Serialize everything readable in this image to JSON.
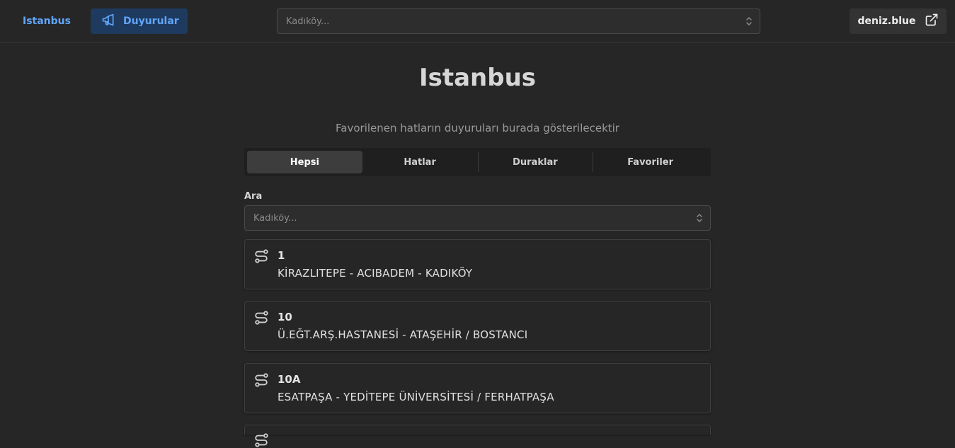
{
  "header": {
    "brand": "Istanbus",
    "active_nav_label": "Duyurular",
    "search_placeholder": "Kadıköy...",
    "external_link_label": "deniz.blue"
  },
  "icons": {
    "nav": "megaphone-icon",
    "external": "external-link-icon",
    "select": "chevron-up-down-icon",
    "route": "route-icon"
  },
  "colors": {
    "accent": "#60a5fa",
    "accent_bg": "#1e3a5f",
    "background": "#262626"
  },
  "main": {
    "title": "Istanbus",
    "subtitle": "Favorilenen hatların duyuruları burada gösterilecektir",
    "tabs": [
      {
        "label": "Hepsi",
        "active": true
      },
      {
        "label": "Hatlar",
        "active": false
      },
      {
        "label": "Duraklar",
        "active": false
      },
      {
        "label": "Favoriler",
        "active": false
      }
    ],
    "search_label": "Ara",
    "search_placeholder": "Kadıköy...",
    "routes": [
      {
        "code": "1",
        "name": "KİRAZLITEPE - ACIBADEM - KADIKÖY"
      },
      {
        "code": "10",
        "name": "Ü.EĞT.ARŞ.HASTANESİ - ATAŞEHİR / BOSTANCI"
      },
      {
        "code": "10A",
        "name": "ESATPAŞA - YEDİTEPE ÜNİVERSİTESİ / FERHATPAŞA"
      }
    ]
  }
}
